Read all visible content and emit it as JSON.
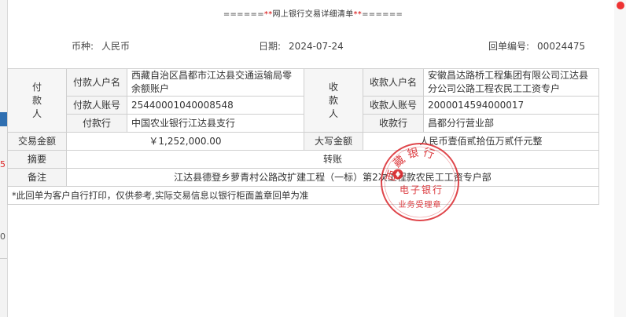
{
  "header": {
    "title_prefix": "======",
    "title_star_left": "**",
    "title_text": "网上银行交易详细清单",
    "title_star_right": "**",
    "title_suffix": "======"
  },
  "meta": {
    "currency_label": "币种:",
    "currency_value": "人民币",
    "date_label": "日期:",
    "date_value": "2024-07-24",
    "receipt_label": "回单编号:",
    "receipt_value": "00024475"
  },
  "payer": {
    "section_label": "付款人",
    "name_label": "付款人户名",
    "name_value": "西藏自治区昌都市江达县交通运输局零余额账户",
    "account_label": "付款人账号",
    "account_value": "25440001040008548",
    "bank_label": "付款行",
    "bank_value": "中国农业银行江达县支行"
  },
  "payee": {
    "section_label": "收款人",
    "name_label": "收款人户名",
    "name_value": "安徽昌达路桥工程集团有限公司江达县分公司公路工程农民工工资专户",
    "account_label": "收款人账号",
    "account_value": "2000014594000017",
    "bank_label": "收款行",
    "bank_value": "昌都分行营业部"
  },
  "amount": {
    "label": "交易金额",
    "value": "￥1,252,000.00",
    "upper_label": "大写金额",
    "upper_value": "人民币壹佰贰拾伍万贰仟元整"
  },
  "summary": {
    "label": "摘要",
    "value": "转账"
  },
  "remark": {
    "label": "备注",
    "value": "江达县德登乡萝青村公路改扩建工程（一标）第2次工程款农民工工资专户部"
  },
  "notice": "*此回单为客户自行打印，仅供参考,实际交易信息以银行柜面盖章回单为准",
  "stamp": {
    "arc_text": "西藏银行",
    "line1": "电子银行",
    "line2": "业务受理章",
    "color": "#d9262b"
  },
  "colors": {
    "border": "#cfcfcf",
    "label_bg": "#f4f4f4",
    "accent_red": "#d40000"
  }
}
